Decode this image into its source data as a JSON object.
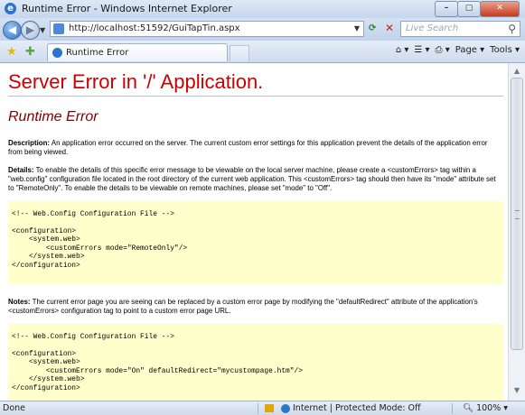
{
  "window": {
    "title": "Runtime Error - Windows Internet Explorer",
    "min_label": "–",
    "max_label": "▢",
    "close_label": "✕"
  },
  "address": {
    "url": "http://localhost:51592/GuiTapTin.aspx",
    "search_placeholder": "Live Search"
  },
  "tab": {
    "label": "Runtime Error"
  },
  "commands": {
    "page_label": "Page",
    "tools_label": "Tools"
  },
  "content": {
    "heading": "Server Error in '/' Application.",
    "subheading": "Runtime Error",
    "description_label": "Description:",
    "description_text": "An application error occurred on the server. The current custom error settings for this application prevent the details of the application error from being viewed.",
    "details_label": "Details:",
    "details_text": "To enable the details of this specific error message to be viewable on the local server machine, please create a <customErrors> tag within a \"web.config\" configuration file located in the root directory of the current web application. This <customErrors> tag should then have its \"mode\" attribute set to \"RemoteOnly\". To enable the details to be viewable on remote machines, please set \"mode\" to \"Off\".",
    "code1": "\n<!-- Web.Config Configuration File -->\n\n<configuration>\n    <system.web>\n        <customErrors mode=\"RemoteOnly\"/>\n    </system.web>\n</configuration>\n",
    "notes_label": "Notes:",
    "notes_text": "The current error page you are seeing can be replaced by a custom error page by modifying the \"defaultRedirect\" attribute of the application's <customErrors> configuration tag to point to a custom error page URL.",
    "code2": "\n<!-- Web.Config Configuration File -->\n\n<configuration>\n    <system.web>\n        <customErrors mode=\"On\" defaultRedirect=\"mycustompage.htm\"/>\n    </system.web>\n</configuration>"
  },
  "status": {
    "left": "Done",
    "zone": "Internet | Protected Mode: Off",
    "zoom": "100%"
  },
  "icons": {
    "back": "back-arrow-icon",
    "forward": "forward-arrow-icon",
    "refresh": "refresh-icon",
    "stop": "stop-icon",
    "search": "search-icon",
    "favorites": "favorites-star-icon",
    "add_favorites": "add-favorites-icon",
    "home": "home-icon",
    "feeds": "feeds-icon",
    "print": "print-icon",
    "globe": "globe-icon"
  },
  "colors": {
    "heading": "#cc0000",
    "subheading": "#800000",
    "code_background": "#ffffcc"
  }
}
